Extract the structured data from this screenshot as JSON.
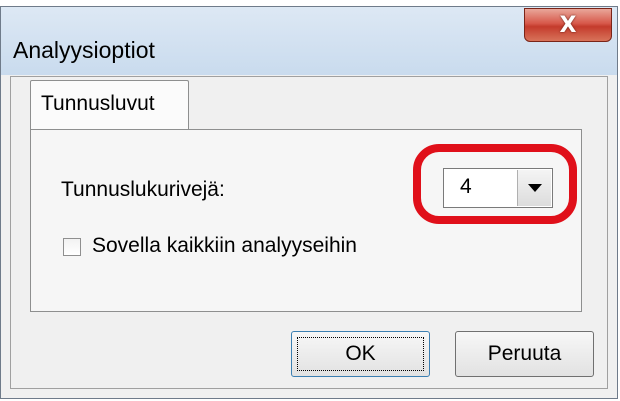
{
  "window": {
    "title": "Analyysioptiot",
    "close_glyph": "X"
  },
  "tabs": [
    {
      "label": "Tunnusluvut",
      "selected": true
    }
  ],
  "form": {
    "rows_label": "Tunnuslukurivejä:",
    "rows_value": "4",
    "apply_all_label": "Sovella kaikkiin analyyseihin",
    "apply_all_checked": false
  },
  "buttons": {
    "ok": "OK",
    "cancel": "Peruuta"
  },
  "colors": {
    "highlight": "#e0101a",
    "close_button": "#c43b2c",
    "dialog_background": "#f0f0f0"
  },
  "icons": {
    "combo_arrow": "chevron-down-icon",
    "close": "close-icon"
  }
}
